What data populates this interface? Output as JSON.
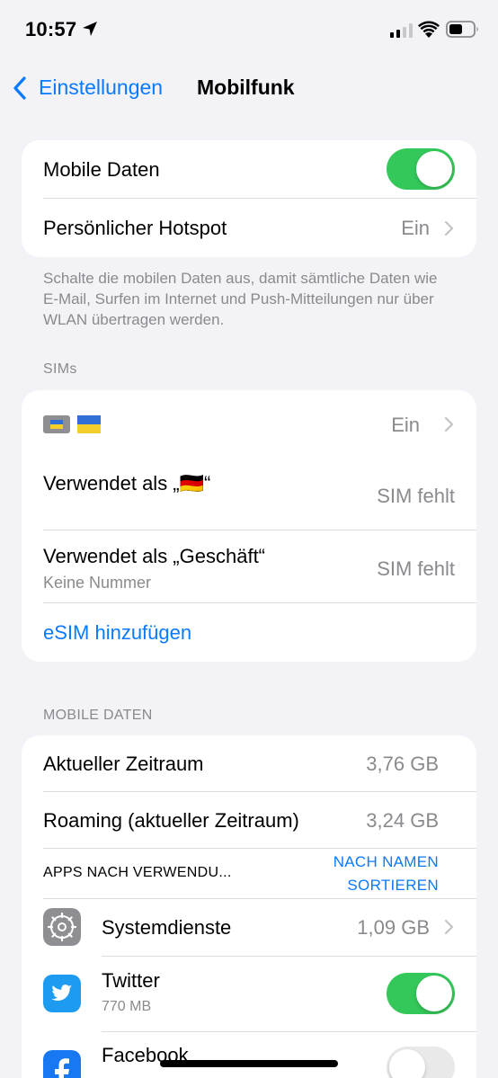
{
  "status_bar": {
    "time": "10:57",
    "icons": [
      "location-arrow-icon",
      "cellular-signal-icon",
      "wifi-icon",
      "battery-icon"
    ]
  },
  "nav": {
    "back_label": "Einstellungen",
    "title": "Mobilfunk"
  },
  "main_card": {
    "mobile_data_label": "Mobile Daten",
    "mobile_data_on": true,
    "hotspot_label": "Persönlicher Hotspot",
    "hotspot_value": "Ein"
  },
  "footnote": "Schalte die mobilen Daten aus, damit sämtliche Daten wie E-Mail, Surfen im Internet und Push-Mitteilungen nur über WLAN übertragen werden.",
  "sims": {
    "header": "SIMs",
    "sim_row_flags": "🇺🇦",
    "sim_row_value": "Ein",
    "used_as_1_label": "Verwendet als „🇩🇪“",
    "used_as_1_value": "SIM fehlt",
    "used_as_2_label": "Verwendet als „Geschäft“",
    "used_as_2_sub": "Keine Nummer",
    "used_as_2_value": "SIM fehlt",
    "add_esim": "eSIM hinzufügen"
  },
  "mobile_data": {
    "header": "MOBILE DATEN",
    "current_period_label": "Aktueller Zeitraum",
    "current_period_value": "3,76 GB",
    "roaming_label": "Roaming (aktueller Zeitraum)",
    "roaming_value": "3,24 GB",
    "apps_by_usage": "APPS NACH VERWENDU...",
    "sort_by_name_line1": "NACH NAMEN",
    "sort_by_name_line2": "SORTIEREN",
    "apps": [
      {
        "name": "Systemdienste",
        "value": "1,09 GB",
        "icon": "gear-icon"
      },
      {
        "name": "Twitter",
        "sub": "770 MB",
        "toggle_on": true,
        "icon": "twitter-bird-icon"
      },
      {
        "name": "Facebook",
        "toggle_on": false,
        "icon": "facebook-f-icon"
      }
    ]
  },
  "colors": {
    "accent": "#0a7aff",
    "toggle_on": "#34c759",
    "background": "#f2f2f7",
    "secondary_text": "#8a8a8e"
  }
}
